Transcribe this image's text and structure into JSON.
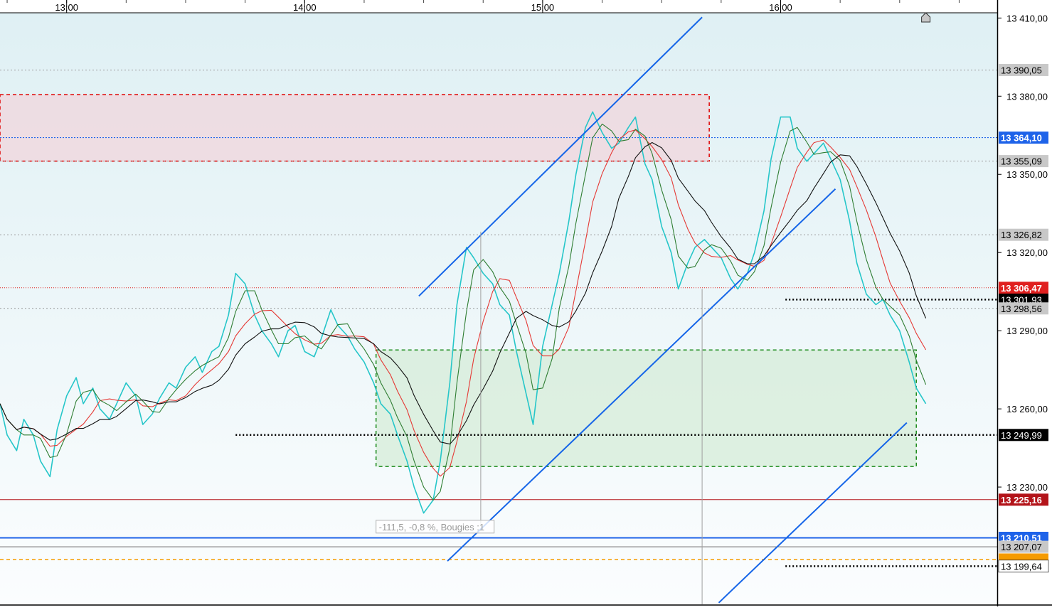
{
  "chart_data": {
    "type": "line",
    "title": "",
    "instrument_currency": "",
    "x_axis": {
      "tick_labels": [
        "13:00",
        "14:00",
        "15:00",
        "16:00"
      ],
      "tick_hours": [
        13,
        14,
        15,
        16
      ],
      "range_hours": [
        12.72,
        16.91
      ]
    },
    "y_axis": {
      "range": [
        13185,
        13412
      ],
      "tick_labels": [
        "13 410,00",
        "13 380,00",
        "13 350,00",
        "13 320,00",
        "13 290,00",
        "13 260,00",
        "13 230,00"
      ],
      "tick_values": [
        13410,
        13380,
        13350,
        13320,
        13290,
        13260,
        13230
      ]
    },
    "price_series": {
      "name": "",
      "color": "#26c6c9",
      "t_hours": [
        12.72,
        12.75,
        12.79,
        12.82,
        12.86,
        12.89,
        12.93,
        12.96,
        13.0,
        13.04,
        13.07,
        13.11,
        13.14,
        13.18,
        13.21,
        13.25,
        13.29,
        13.32,
        13.36,
        13.39,
        13.43,
        13.46,
        13.5,
        13.54,
        13.57,
        13.61,
        13.64,
        13.68,
        13.71,
        13.75,
        13.79,
        13.82,
        13.86,
        13.89,
        13.93,
        13.96,
        14.0,
        14.04,
        14.07,
        14.11,
        14.14,
        14.18,
        14.21,
        14.25,
        14.29,
        14.32,
        14.36,
        14.39,
        14.43,
        14.46,
        14.5,
        14.54,
        14.57,
        14.61,
        14.64,
        14.68,
        14.71,
        14.75,
        14.79,
        14.82,
        14.86,
        14.89,
        14.93,
        14.96,
        15.0,
        15.04,
        15.07,
        15.11,
        15.14,
        15.18,
        15.21,
        15.25,
        15.29,
        15.32,
        15.36,
        15.39,
        15.43,
        15.46,
        15.5,
        15.54,
        15.57,
        15.61,
        15.64,
        15.68,
        15.71,
        15.75,
        15.79,
        15.82,
        15.86,
        15.89,
        15.93,
        15.96,
        16.0,
        16.04,
        16.07,
        16.11,
        16.14,
        16.18,
        16.21,
        16.25,
        16.29,
        16.32,
        16.36,
        16.4,
        16.43,
        16.46,
        16.5,
        16.54,
        16.57,
        16.61
      ],
      "values": [
        13262,
        13250,
        13244,
        13256,
        13250,
        13240,
        13234,
        13252,
        13265,
        13272,
        13262,
        13268,
        13260,
        13256,
        13262,
        13270,
        13265,
        13254,
        13258,
        13264,
        13270,
        13268,
        13276,
        13280,
        13274,
        13282,
        13284,
        13296,
        13312,
        13308,
        13296,
        13290,
        13285,
        13280,
        13290,
        13292,
        13282,
        13280,
        13287,
        13298,
        13292,
        13288,
        13283,
        13278,
        13270,
        13262,
        13258,
        13250,
        13240,
        13230,
        13220,
        13225,
        13240,
        13270,
        13300,
        13322,
        13318,
        13312,
        13308,
        13300,
        13296,
        13282,
        13266,
        13254,
        13284,
        13300,
        13312,
        13332,
        13350,
        13368,
        13374,
        13366,
        13360,
        13362,
        13368,
        13372,
        13354,
        13348,
        13330,
        13320,
        13306,
        13316,
        13322,
        13325,
        13322,
        13318,
        13310,
        13306,
        13312,
        13320,
        13336,
        13356,
        13372,
        13372,
        13360,
        13355,
        13358,
        13362,
        13356,
        13348,
        13332,
        13316,
        13304,
        13300,
        13302,
        13296,
        13290,
        13278,
        13268,
        13262,
        13258,
        13254,
        13256,
        13264,
        13258,
        13236,
        13226
      ]
    },
    "ma_series": [
      {
        "name": "",
        "color": "#e53935",
        "window": 6
      },
      {
        "name": "",
        "color": "#2e7d32",
        "window": 3
      },
      {
        "name": "",
        "color": "#111111",
        "window": 10
      }
    ],
    "price_tags": [
      {
        "label": "13 390,05",
        "value": 13390.05,
        "bg": "#c8c8c8",
        "fg": "#000000",
        "line": "dotted-gray"
      },
      {
        "label": "13 364,10",
        "value": 13364.1,
        "bg": "#1e63e9",
        "fg": "#ffffff",
        "line": "dotted-blue"
      },
      {
        "label": "13 355,09",
        "value": 13355.09,
        "bg": "#c8c8c8",
        "fg": "#000000",
        "line": "dotted-gray"
      },
      {
        "label": "13 326,82",
        "value": 13326.82,
        "bg": "#c8c8c8",
        "fg": "#000000",
        "line": "dotted-gray"
      },
      {
        "label": "13 306,47",
        "value": 13306.47,
        "bg": "#e0201f",
        "fg": "#ffffff",
        "line": "dotted-red"
      },
      {
        "label": "13 301,93",
        "value": 13301.93,
        "bg": "#000000",
        "fg": "#ffffff",
        "line": "dotted-black-short"
      },
      {
        "label": "13 298,56",
        "value": 13298.56,
        "bg": "#c8c8c8",
        "fg": "#000000",
        "line": "dotted-gray"
      },
      {
        "label": "13 249,99",
        "value": 13249.99,
        "bg": "#000000",
        "fg": "#ffffff",
        "line": "dotted-black"
      },
      {
        "label": "13 225,16",
        "value": 13225.16,
        "bg": "#b3141a",
        "fg": "#ffffff",
        "line": "solid-red"
      },
      {
        "label": "13 210,51",
        "value": 13210.51,
        "bg": "#1e63e9",
        "fg": "#ffffff",
        "line": "solid-blue"
      },
      {
        "label": "13 207,07",
        "value": 13207.07,
        "bg": "#c8c8c8",
        "fg": "#000000",
        "line": "solid-gray"
      },
      {
        "label": "",
        "value": 13202.2,
        "bg": "#f59b00",
        "fg": "#f59b00",
        "line": "dashed-orange"
      },
      {
        "label": "13 199,64",
        "value": 13199.64,
        "bg": "#ffffff",
        "fg": "#000000",
        "line": "dotted-black-short"
      }
    ],
    "zones": [
      {
        "name": "resistance-zone",
        "t_start": 12.72,
        "t_end": 15.7,
        "v_low": 13355.09,
        "v_high": 13380.6,
        "fill": "#f0d6dc",
        "border": "#e00000"
      },
      {
        "name": "support-zone",
        "t_start": 14.3,
        "t_end": 16.57,
        "v_low": 13237.9,
        "v_high": 13282.6,
        "fill": "#d6ecd8",
        "border": "#1a8a1a"
      }
    ],
    "trend_lines": [
      {
        "from": [
          14.48,
          13303.3
        ],
        "to": [
          15.67,
          13410.3
        ],
        "color": "#1565e8"
      },
      {
        "from": [
          14.6,
          13201.6
        ],
        "to": [
          16.23,
          13344.4
        ],
        "color": "#1565e8"
      },
      {
        "from": [
          15.74,
          13185.6
        ],
        "to": [
          16.53,
          13254.7
        ],
        "color": "#1565e8"
      }
    ],
    "measure": {
      "label": "-111,5, -0,8 %, Bougies :1",
      "t_hours": [
        14.74,
        15.67
      ],
      "from_value": 13328,
      "to_value": 13216,
      "label_value": 13214.8
    },
    "current_price_marker": {
      "t_hour": 16.61,
      "value": 13407
    }
  }
}
